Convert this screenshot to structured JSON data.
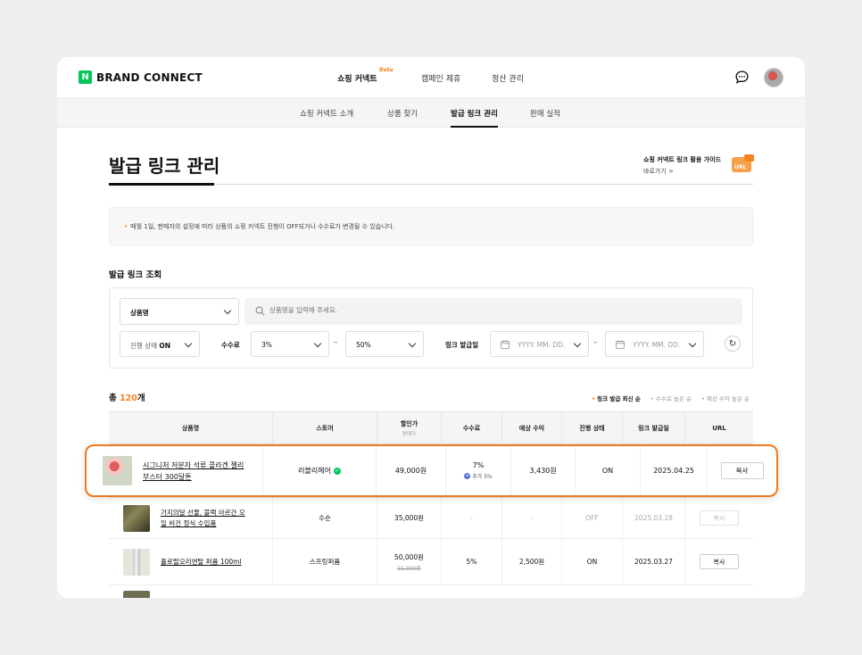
{
  "header": {
    "logo_mark": "N",
    "logo_text": "BRAND CONNECT",
    "menu": [
      {
        "label": "쇼핑 커넥트",
        "badge": "Beta"
      },
      {
        "label": "캠페인 제휴"
      },
      {
        "label": "정산 관리"
      }
    ],
    "icons": {
      "chat": "chat-bubble-icon",
      "profile": "avatar"
    }
  },
  "sub_nav": [
    "쇼핑 커넥트 소개",
    "상품 찾기",
    "발급 링크 관리",
    "판매 실적"
  ],
  "page": {
    "title": "발급 링크 관리",
    "guide_title": "쇼핑 커넥트 링크 활용 가이드",
    "guide_link": "바로가기 >",
    "guide_badge": "URL",
    "notice": "매월 1일, 판매자의 설정에 따라 상품의 쇼핑 커넥트 진행이 OFF되거나 수수료가 변경될 수 있습니다."
  },
  "search": {
    "section_title": "발급 링크 조회",
    "type_select": "상품명",
    "placeholder": "상품명을 입력해 주세요.",
    "status_label": "진행 상태",
    "status_value": "ON",
    "commission_label": "수수료",
    "commission_min": "3%",
    "commission_max": "50%",
    "date_label": "링크 발급일",
    "date_placeholder_start": "YYYY. MM. DD.",
    "date_placeholder_end": "YYYY. MM. DD.",
    "dash": "–",
    "refresh_icon": "↻"
  },
  "results": {
    "total_prefix": "총 ",
    "total_count": "120",
    "total_suffix": "개",
    "sort": [
      "링크 발급 최신 순",
      "수수료 높은 순",
      "예상 수익 높은 순"
    ]
  },
  "table": {
    "headers": {
      "product": "상품명",
      "store": "스토어",
      "price": "할인가",
      "price_sub": "판매가",
      "commission": "수수료",
      "revenue": "예상 수익",
      "status": "진행 상태",
      "date": "링크 발급일",
      "url": "URL"
    },
    "highlight_row": {
      "product": "시그니처 저분자 석류 콜라겐 젤리 부스터 300달톤",
      "store": "러블리헤어",
      "price": "49,000원",
      "commission": "7%",
      "commission_extra": "추가 5%",
      "revenue": "3,430원",
      "status": "ON",
      "date": "2025.04.25",
      "button": "복사"
    },
    "rows": [
      {
        "product": "가지의달 선물, 블랙 아르간 오일 비건 정식 수입품",
        "store": "수순",
        "price": "35,000원",
        "commission": "-",
        "revenue": "-",
        "status": "OFF",
        "date": "2025.03.28",
        "button": "복사"
      },
      {
        "product": "플로럴오리엔탈 퍼퓸 100ml",
        "store": "스프링퍼퓸",
        "price": "50,000원",
        "price_original": "55,000원",
        "commission": "5%",
        "revenue": "2,500원",
        "status": "ON",
        "date": "2025.03.27",
        "button": "복사"
      }
    ]
  },
  "colors": {
    "accent": "#f5821f",
    "brand": "#03c75a",
    "highlight_border": "#f07a1e"
  }
}
